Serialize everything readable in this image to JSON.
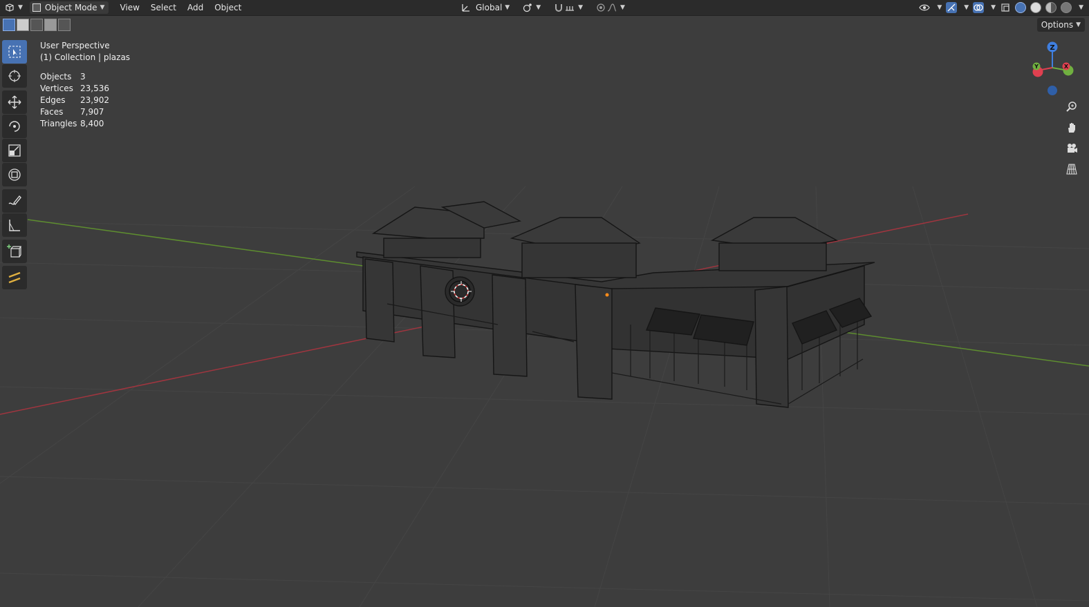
{
  "header": {
    "editor_type_icon": "3d-viewport-icon",
    "mode": "Object Mode",
    "menus": [
      "View",
      "Select",
      "Add",
      "Object"
    ],
    "transform_orientation": "Global",
    "pivot_icon": "pivot-point-icon",
    "snap_icon": "snap-magnet-icon",
    "proportional_icon": "proportional-edit-icon",
    "right_icons": [
      "visibility-eye-icon",
      "gizmo-toggle-icon",
      "overlays-icon",
      "xray-icon"
    ],
    "shading_modes": [
      "wireframe",
      "solid",
      "material",
      "rendered"
    ],
    "active_shading": "wireframe"
  },
  "options_label": "Options",
  "tools": [
    "select-box",
    "cursor",
    "move",
    "rotate",
    "scale",
    "transform",
    "annotate",
    "measure",
    "add-cube",
    "grease-pencil"
  ],
  "overlay": {
    "view_name": "User Perspective",
    "collection": "(1) Collection | plazas",
    "stats": [
      {
        "label": "Objects",
        "value": "3"
      },
      {
        "label": "Vertices",
        "value": "23,536"
      },
      {
        "label": "Edges",
        "value": "23,902"
      },
      {
        "label": "Faces",
        "value": "7,907"
      },
      {
        "label": "Triangles",
        "value": "8,400"
      }
    ]
  },
  "gizmo": {
    "z_label": "Z",
    "y_label": "Y",
    "x_label": "X",
    "colors": {
      "x": "#e04050",
      "y": "#70b040",
      "z": "#3f7fe0"
    }
  },
  "colors": {
    "background": "#3d3d3d",
    "header": "#2b2b2b",
    "accent": "#4772b3",
    "axis_x": "#a0353f",
    "axis_y": "#5e8e2f"
  }
}
